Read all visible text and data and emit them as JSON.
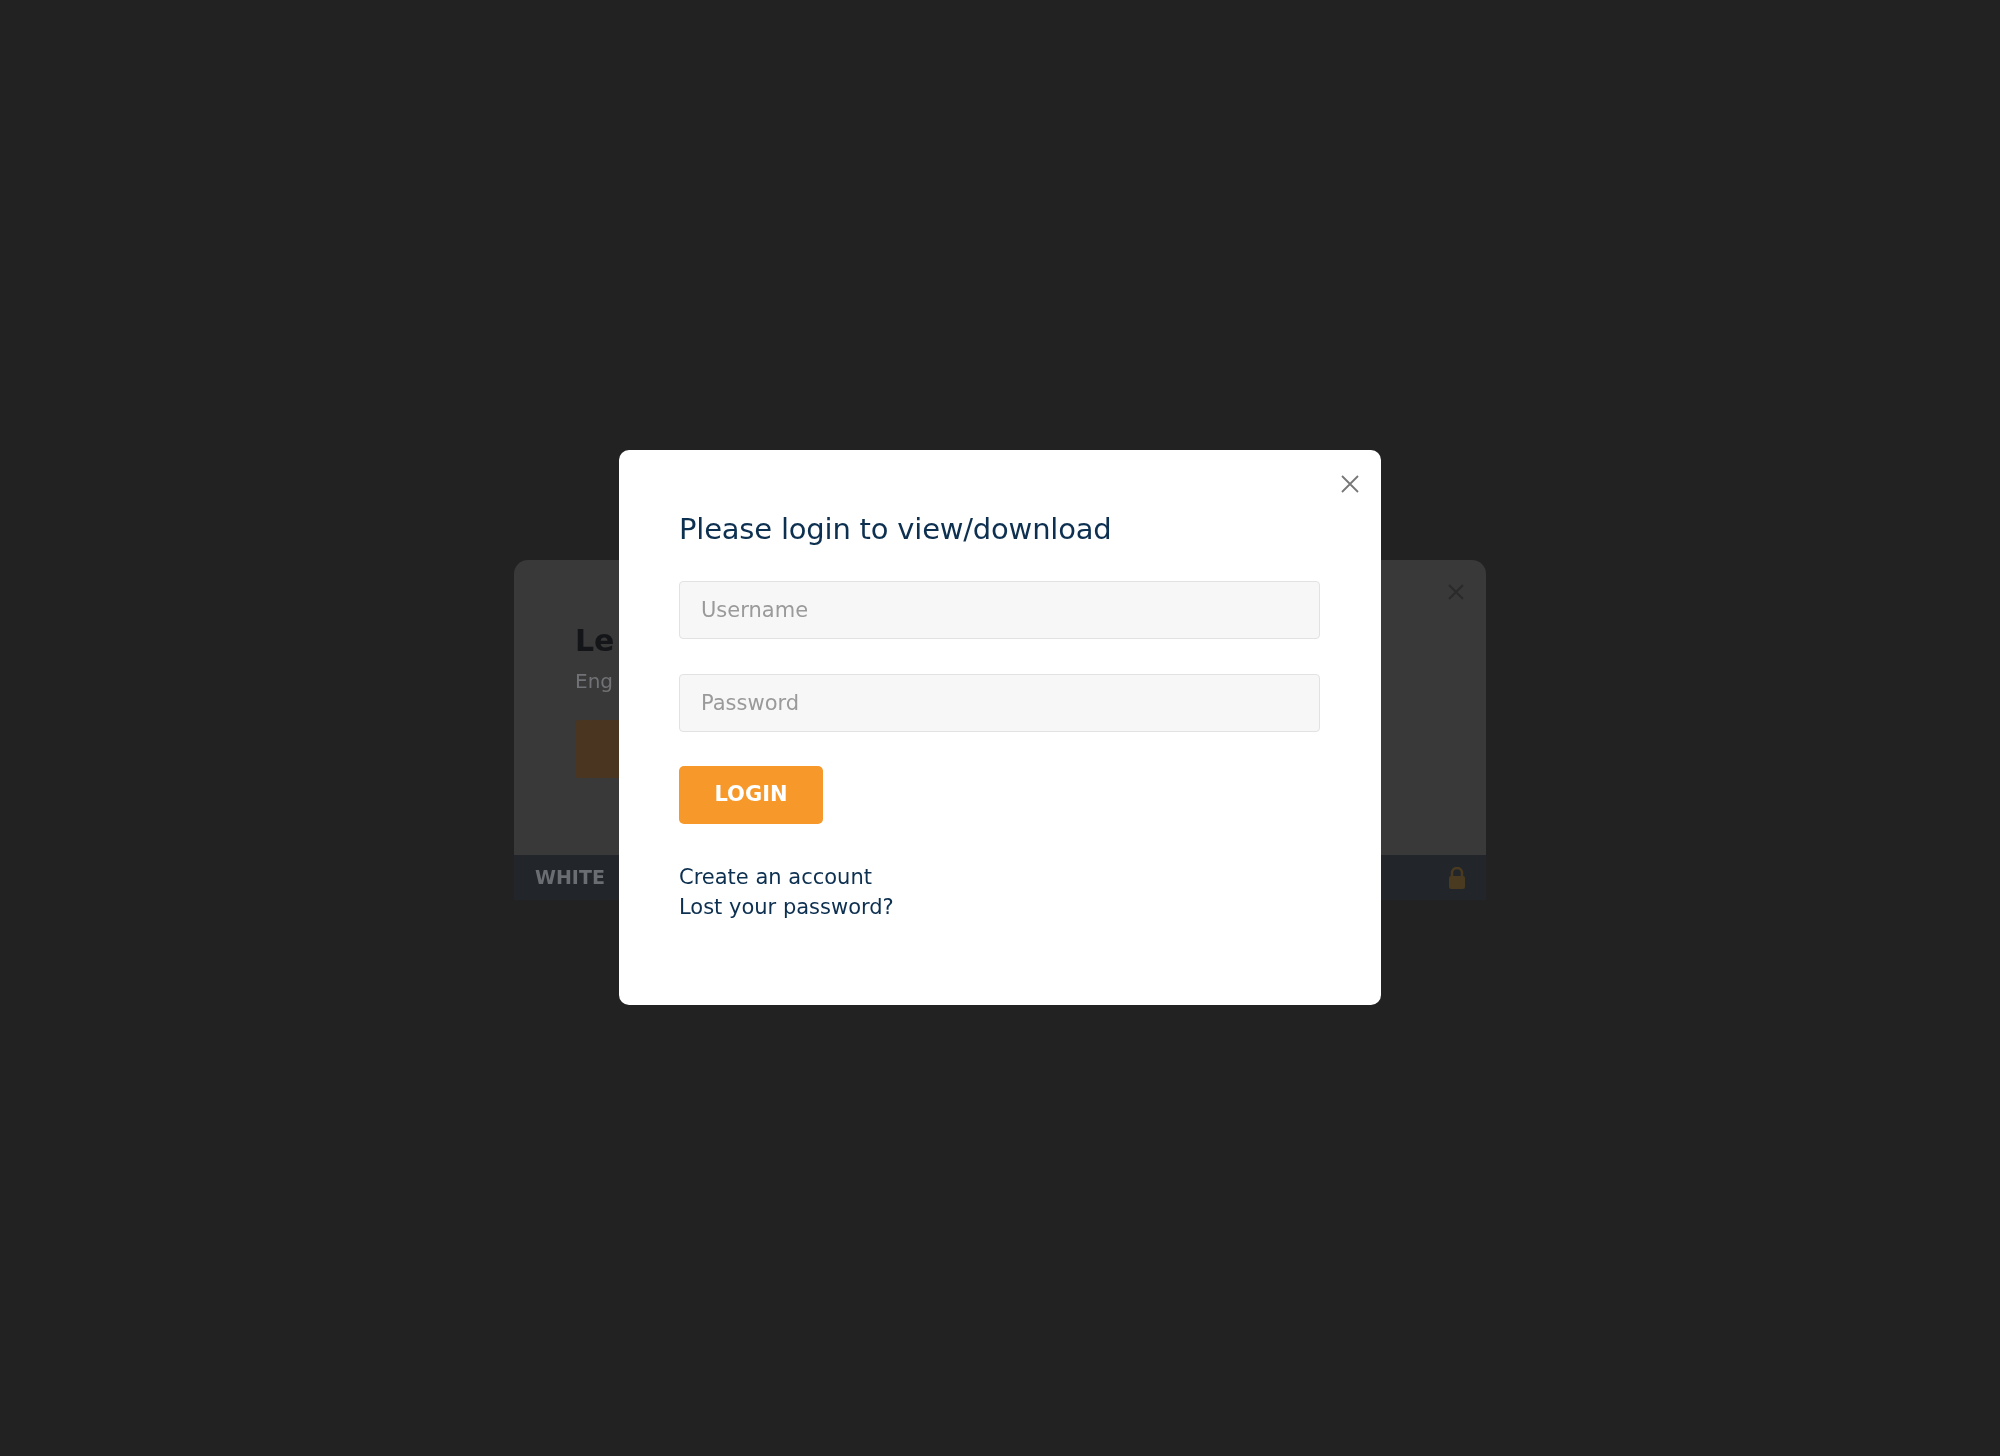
{
  "background_dialog": {
    "title": "Le",
    "subtitle": "Eng",
    "footer_label": "WHITE"
  },
  "login_dialog": {
    "title": "Please login to view/download",
    "fields": [
      {
        "placeholder": "Username"
      },
      {
        "placeholder": "Password"
      }
    ],
    "submit": "LOGIN",
    "links": [
      "Create an account",
      "Lost your password?"
    ]
  }
}
